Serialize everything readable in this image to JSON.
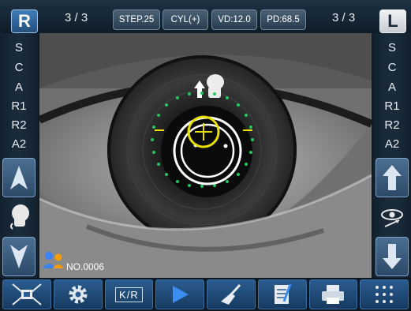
{
  "topbar": {
    "left_eye": "R",
    "left_counter": "3 / 3",
    "chips": [
      "STEP.25",
      "CYL(+)",
      "VD:12.0",
      "PD:68.5"
    ],
    "right_counter": "3 / 3",
    "right_eye": "L"
  },
  "left_modes": [
    "S",
    "C",
    "A",
    "R1",
    "R2",
    "A2"
  ],
  "right_modes": [
    "S",
    "C",
    "A",
    "R1",
    "R2",
    "A2"
  ],
  "record": {
    "label": "NO.0006"
  },
  "toolbar": {
    "kr_label": "K/R",
    "icons": [
      "alignment-icon",
      "gear-icon",
      "kr-mode-icon",
      "play-icon",
      "brush-icon",
      "notes-icon",
      "printer-icon",
      "grid-menu-icon"
    ]
  },
  "colors": {
    "accent": "#2b5c8f",
    "overlay_yellow": "#e8e000",
    "overlay_green": "#22c55e"
  }
}
